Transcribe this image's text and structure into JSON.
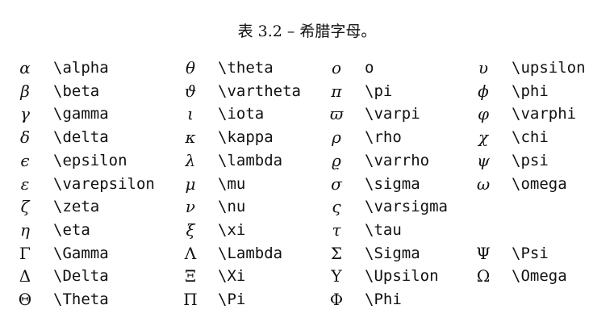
{
  "caption": {
    "label": "表 3.2",
    "separator": "–",
    "title": "希腊字母。"
  },
  "rows": [
    {
      "cells": [
        {
          "sym": "α",
          "cmd": "\\alpha"
        },
        {
          "sym": "θ",
          "cmd": "\\theta"
        },
        {
          "sym": "o",
          "cmd": "o"
        },
        {
          "sym": "υ",
          "cmd": "\\upsilon"
        }
      ]
    },
    {
      "cells": [
        {
          "sym": "β",
          "cmd": "\\beta"
        },
        {
          "sym": "ϑ",
          "cmd": "\\vartheta"
        },
        {
          "sym": "π",
          "cmd": "\\pi"
        },
        {
          "sym": "ϕ",
          "cmd": "\\phi"
        }
      ]
    },
    {
      "cells": [
        {
          "sym": "γ",
          "cmd": "\\gamma"
        },
        {
          "sym": "ι",
          "cmd": "\\iota"
        },
        {
          "sym": "ϖ",
          "cmd": "\\varpi"
        },
        {
          "sym": "φ",
          "cmd": "\\varphi"
        }
      ]
    },
    {
      "cells": [
        {
          "sym": "δ",
          "cmd": "\\delta"
        },
        {
          "sym": "κ",
          "cmd": "\\kappa"
        },
        {
          "sym": "ρ",
          "cmd": "\\rho"
        },
        {
          "sym": "χ",
          "cmd": "\\chi"
        }
      ]
    },
    {
      "cells": [
        {
          "sym": "ϵ",
          "cmd": "\\epsilon"
        },
        {
          "sym": "λ",
          "cmd": "\\lambda"
        },
        {
          "sym": "ϱ",
          "cmd": "\\varrho"
        },
        {
          "sym": "ψ",
          "cmd": "\\psi"
        }
      ]
    },
    {
      "cells": [
        {
          "sym": "ε",
          "cmd": "\\varepsilon"
        },
        {
          "sym": "μ",
          "cmd": "\\mu"
        },
        {
          "sym": "σ",
          "cmd": "\\sigma"
        },
        {
          "sym": "ω",
          "cmd": "\\omega"
        }
      ]
    },
    {
      "cells": [
        {
          "sym": "ζ",
          "cmd": "\\zeta"
        },
        {
          "sym": "ν",
          "cmd": "\\nu"
        },
        {
          "sym": "ς",
          "cmd": "\\varsigma"
        },
        {
          "sym": "",
          "cmd": ""
        }
      ]
    },
    {
      "cells": [
        {
          "sym": "η",
          "cmd": "\\eta"
        },
        {
          "sym": "ξ",
          "cmd": "\\xi"
        },
        {
          "sym": "τ",
          "cmd": "\\tau"
        },
        {
          "sym": "",
          "cmd": ""
        }
      ]
    },
    {
      "cells": [
        {
          "sym": "Γ",
          "cmd": "\\Gamma"
        },
        {
          "sym": "Λ",
          "cmd": "\\Lambda"
        },
        {
          "sym": "Σ",
          "cmd": "\\Sigma"
        },
        {
          "sym": "Ψ",
          "cmd": "\\Psi"
        }
      ]
    },
    {
      "cells": [
        {
          "sym": "Δ",
          "cmd": "\\Delta"
        },
        {
          "sym": "Ξ",
          "cmd": "\\Xi"
        },
        {
          "sym": "Υ",
          "cmd": "\\Upsilon"
        },
        {
          "sym": "Ω",
          "cmd": "\\Omega"
        }
      ]
    },
    {
      "cells": [
        {
          "sym": "Θ",
          "cmd": "\\Theta"
        },
        {
          "sym": "Π",
          "cmd": "\\Pi"
        },
        {
          "sym": "Φ",
          "cmd": "\\Phi"
        },
        {
          "sym": "",
          "cmd": ""
        }
      ]
    }
  ]
}
